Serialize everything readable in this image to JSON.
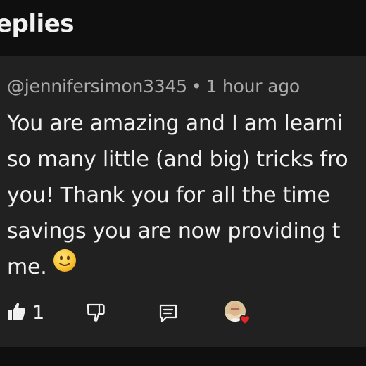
{
  "header": {
    "title": "eplies"
  },
  "comment": {
    "author": "@jennifersimon3345",
    "separator": "•",
    "time": "1 hour ago",
    "lines": [
      "You are amazing and I am learni",
      "so many little (and big) tricks fro",
      "you! Thank you for all the time",
      "savings you are now providing t",
      "me."
    ],
    "like_count": "1"
  },
  "icons": {
    "like": "thumbs-up-icon",
    "dislike": "thumbs-down-icon",
    "reply": "comment-icon",
    "creator_heart": "creator-heart-avatar-icon",
    "emoji": "slightly-smiling-face-emoji"
  },
  "colors": {
    "background": "#0f0f0f",
    "card": "#212121",
    "text": "#f1f1f1",
    "meta": "#aaaaaa",
    "heart": "#e8232c"
  }
}
